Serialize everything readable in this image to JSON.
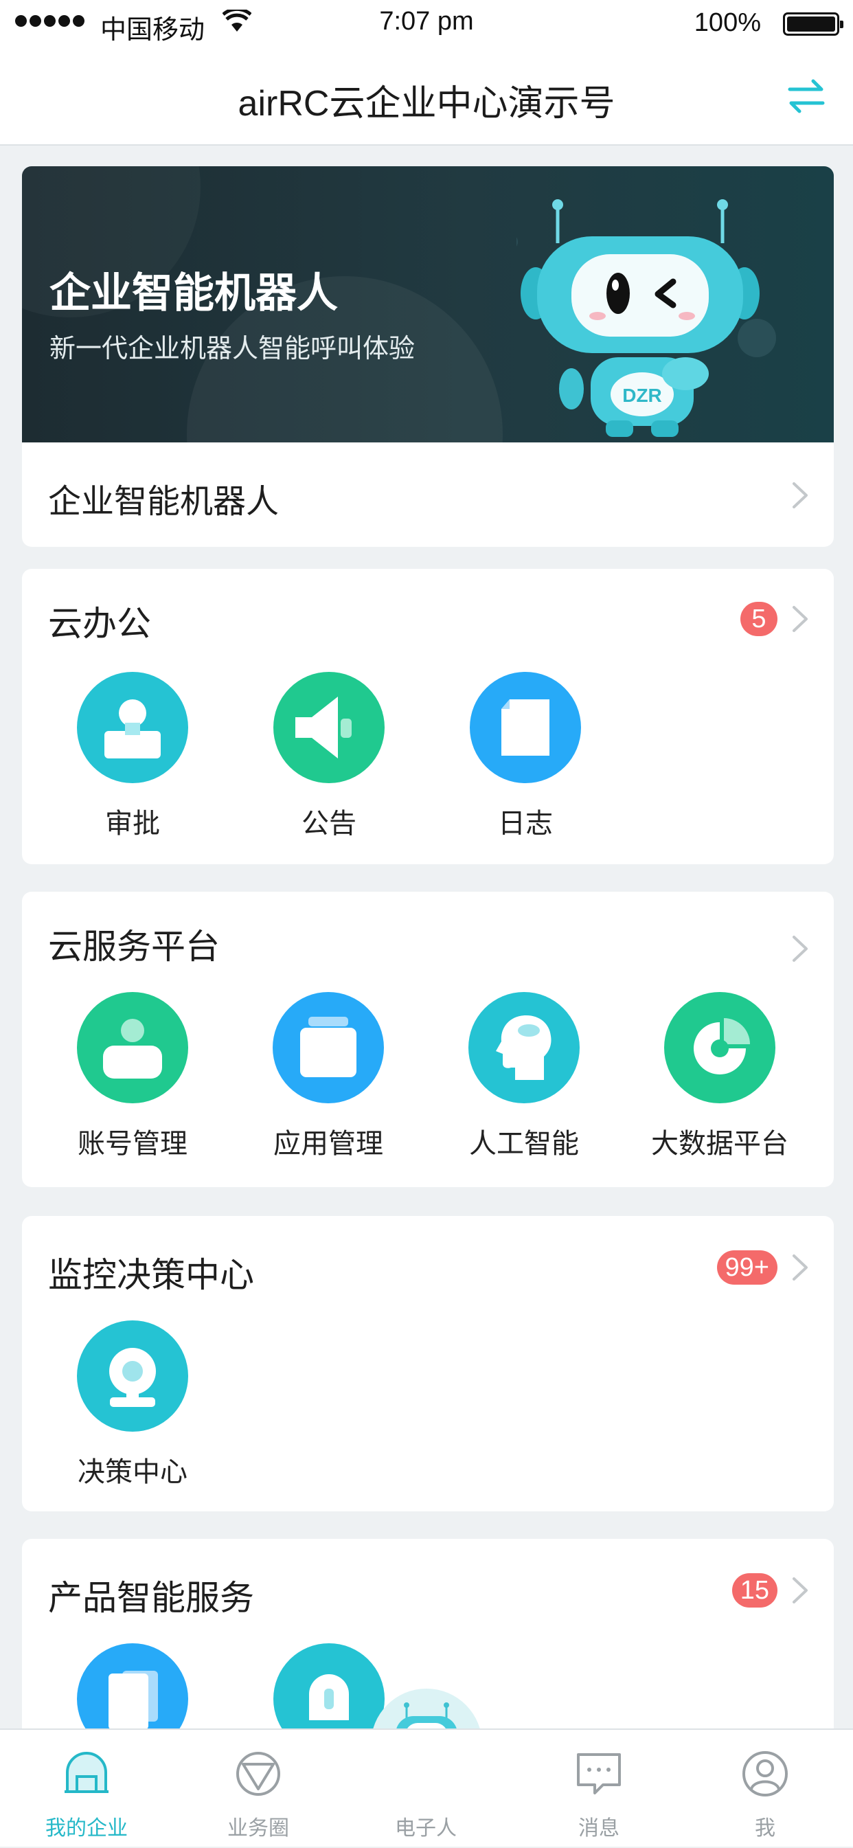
{
  "status_bar": {
    "carrier": "中国移动",
    "time": "7:07 pm",
    "battery": "100%"
  },
  "header": {
    "title": "airRC云企业中心演示号",
    "switch_icon": "swap-arrows-icon"
  },
  "banner": {
    "title": "企业智能机器人",
    "subtitle": "新一代企业机器人智能呼叫体验",
    "robot_badge": "DZR",
    "link_label": "企业智能机器人"
  },
  "sections": [
    {
      "title": "云办公",
      "badge": "5",
      "items": [
        {
          "label": "审批",
          "icon": "approval-icon"
        },
        {
          "label": "公告",
          "icon": "announcement-icon"
        },
        {
          "label": "日志",
          "icon": "log-icon"
        }
      ]
    },
    {
      "title": "云服务平台",
      "badge": "",
      "items": [
        {
          "label": "账号管理",
          "icon": "account-icon"
        },
        {
          "label": "应用管理",
          "icon": "apps-icon"
        },
        {
          "label": "人工智能",
          "icon": "ai-head-icon"
        },
        {
          "label": "大数据平台",
          "icon": "pie-chart-icon"
        }
      ]
    },
    {
      "title": "监控决策中心",
      "badge": "99+",
      "items": [
        {
          "label": "决策中心",
          "icon": "camera-icon"
        }
      ]
    },
    {
      "title": "产品智能服务",
      "badge": "15",
      "items": [
        {
          "label": "",
          "icon": "document-icon"
        },
        {
          "label": "",
          "icon": "alarm-light-icon"
        }
      ]
    }
  ],
  "tabbar": {
    "tabs": [
      {
        "label": "我的企业",
        "icon": "enterprise-icon",
        "active": true
      },
      {
        "label": "业务圈",
        "icon": "business-circle-icon",
        "active": false
      },
      {
        "label": "电子人",
        "icon": "robot-icon",
        "active": false
      },
      {
        "label": "消息",
        "icon": "message-icon",
        "active": false
      },
      {
        "label": "我",
        "icon": "profile-icon",
        "active": false
      }
    ]
  },
  "colors": {
    "teal": "#25c3d3",
    "green": "#20c98f",
    "blue": "#27aaf8",
    "badge": "#f46a6a",
    "tab_active": "#25b8c8"
  }
}
